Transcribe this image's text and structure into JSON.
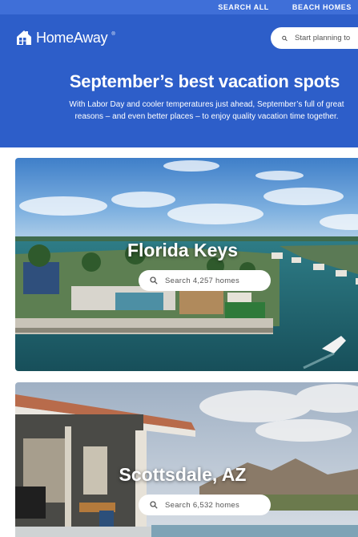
{
  "nav": {
    "links": [
      "SEARCH ALL",
      "BEACH HOMES"
    ]
  },
  "header": {
    "logo_text": "HomeAway",
    "logo_tm": "®",
    "search_placeholder": "Start planning to"
  },
  "hero": {
    "title": "September’s best vacation spots",
    "subtitle": "With Labor Day and cooler temperatures just ahead, September’s full of great reasons – and even better places – to enjoy quality vacation time together."
  },
  "destinations": [
    {
      "name": "Florida Keys",
      "search_label": "Search 4,257 homes"
    },
    {
      "name": "Scottsdale, AZ",
      "search_label": "Search 6,532 homes"
    }
  ],
  "colors": {
    "brand_blue": "#2d5ec9",
    "nav_blue": "#3f6fd8"
  }
}
